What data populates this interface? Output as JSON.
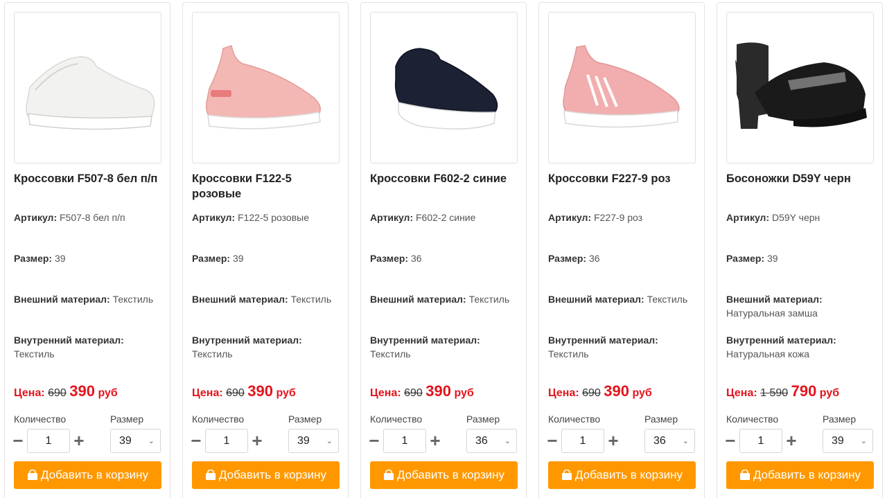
{
  "labels": {
    "article": "Артикул:",
    "size": "Размер:",
    "outer": "Внешний материал:",
    "inner": "Внутренний материал:",
    "price": "Цена:",
    "currency": "руб",
    "quantity": "Количество",
    "size_select": "Размер",
    "add_to_cart": "Добавить в корзину"
  },
  "colors": {
    "accent": "#ff9800",
    "price": "#e3141c"
  },
  "products": [
    {
      "title": "Кроссовки F507-8 бел п/п",
      "article": "F507-8 бел п/п",
      "size": "39",
      "outer_material": "Текстиль",
      "inner_material": "Текстиль",
      "old_price": "690",
      "new_price": "390",
      "quantity": "1",
      "selected_size": "39",
      "shoe_color": "#f2f2f0",
      "sole_color": "#ffffff"
    },
    {
      "title": "Кроссовки F122-5 розовые",
      "article": "F122-5 розовые",
      "size": "39",
      "outer_material": "Текстиль",
      "inner_material": "Текстиль",
      "old_price": "690",
      "new_price": "390",
      "quantity": "1",
      "selected_size": "39",
      "shoe_color": "#f4b8b4",
      "sole_color": "#ffffff"
    },
    {
      "title": "Кроссовки F602-2 синие",
      "article": "F602-2 синие",
      "size": "36",
      "outer_material": "Текстиль",
      "inner_material": "Текстиль",
      "old_price": "690",
      "new_price": "390",
      "quantity": "1",
      "selected_size": "36",
      "shoe_color": "#1c2233",
      "sole_color": "#ffffff"
    },
    {
      "title": "Кроссовки F227-9 роз",
      "article": "F227-9 роз",
      "size": "36",
      "outer_material": "Текстиль",
      "inner_material": "Текстиль",
      "old_price": "690",
      "new_price": "390",
      "quantity": "1",
      "selected_size": "36",
      "shoe_color": "#f2aeae",
      "sole_color": "#ffffff"
    },
    {
      "title": "Босоножки D59Y черн",
      "article": "D59Y черн",
      "size": "39",
      "outer_material": "Натуральная замша",
      "inner_material": "Натуральная кожа",
      "old_price": "1 590",
      "new_price": "790",
      "quantity": "1",
      "selected_size": "39",
      "shoe_color": "#1a1a1a",
      "sole_color": "#2a2a2a"
    }
  ]
}
